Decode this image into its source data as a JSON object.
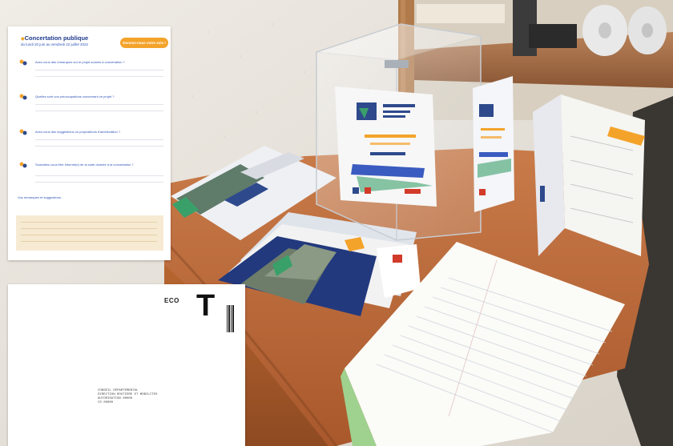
{
  "form_card": {
    "title": "Concertation publique",
    "subtitle": "du lundi 20 juin au vendredi 22 juillet 2022",
    "badge": "Donnez-nous votre avis !",
    "questions": [
      "Avez-vous des remarques sur le projet soumis à concertation ?",
      "Quelles sont vos préoccupations concernant ce projet ?",
      "Avez-vous des suggestions ou propositions d'amélioration ?",
      "Souhaitez-vous être informé(e) de la suite donnée à la concertation ?"
    ],
    "suggestions_label": "Vos remarques et suggestions :"
  },
  "envelope_card": {
    "eco": "ECO",
    "stamp_letter": "T",
    "address": "CONSEIL DEPARTEMENTAL\nDIRECTION ROUTIERE ET MOBILITES\nAUTORISATION 00000\nCS 00000"
  },
  "scene_colors": {
    "wall": "#ece6de",
    "desk": "#b8683a",
    "brand_blue": "#1f3b8c",
    "accent_orange": "#f4a32a",
    "accent_green": "#3aa06a"
  }
}
